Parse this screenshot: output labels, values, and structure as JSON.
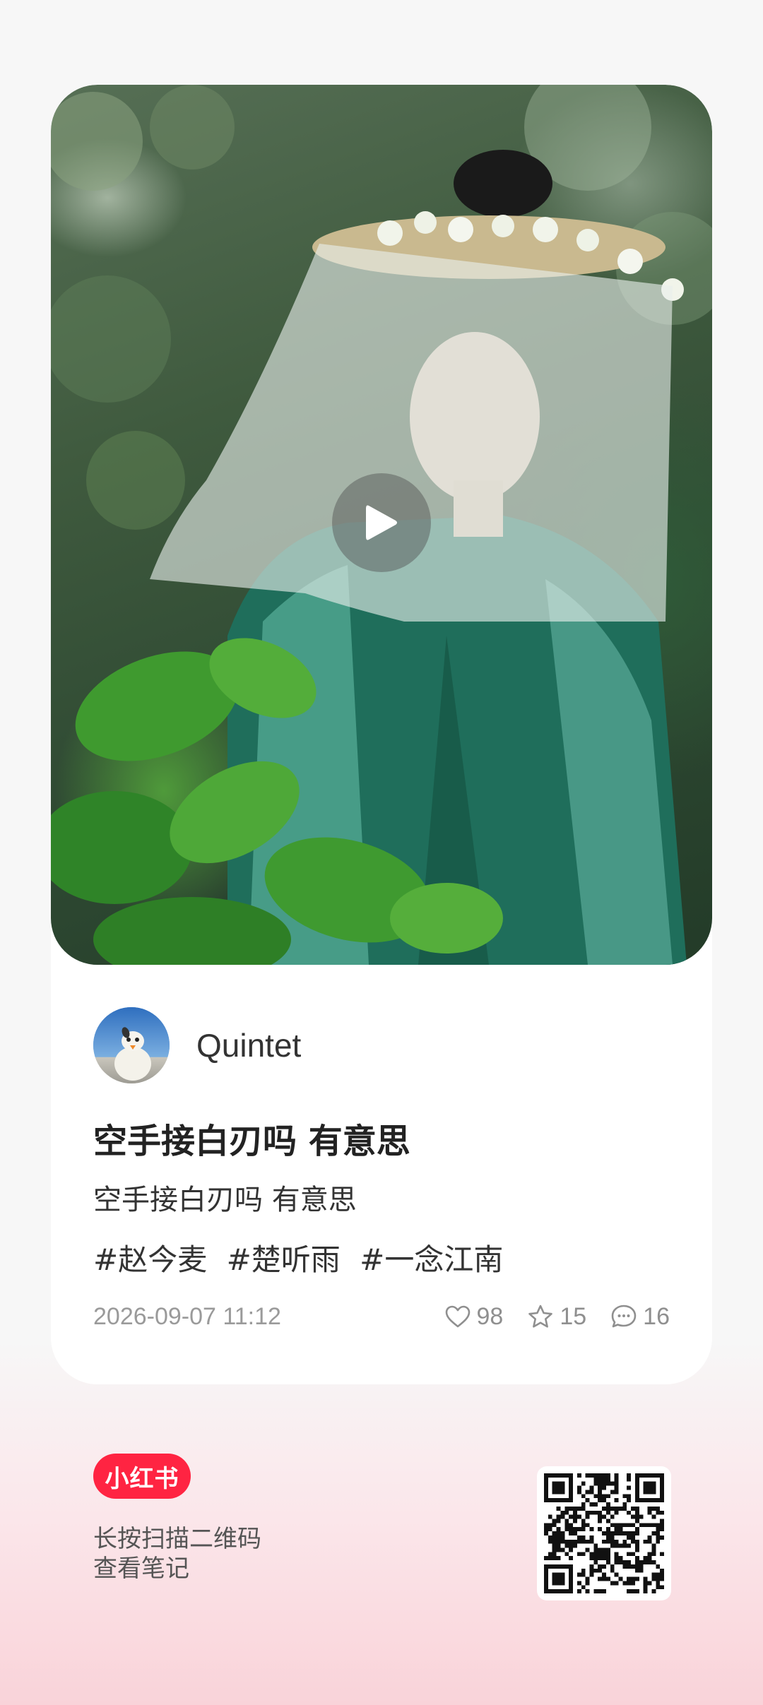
{
  "post": {
    "author_name": "Quintet",
    "title": "空手接白刃吗 有意思",
    "description": "空手接白刃吗 有意思",
    "tags": [
      "#赵今麦",
      "#楚听雨",
      "#一念江南"
    ],
    "date": "2026-09-07 11:12",
    "likes": "98",
    "favorites": "15",
    "comments": "16"
  },
  "icons": {
    "play": "play-icon",
    "like": "heart-icon",
    "favorite": "star-icon",
    "comment": "comment-icon"
  },
  "footer": {
    "brand_label": "小红书",
    "scan_line1": "长按扫描二维码",
    "scan_line2": "查看笔记"
  },
  "colors": {
    "brand": "#ff2442",
    "meta_gray": "#9a9a9a",
    "card_bg": "#ffffff"
  }
}
